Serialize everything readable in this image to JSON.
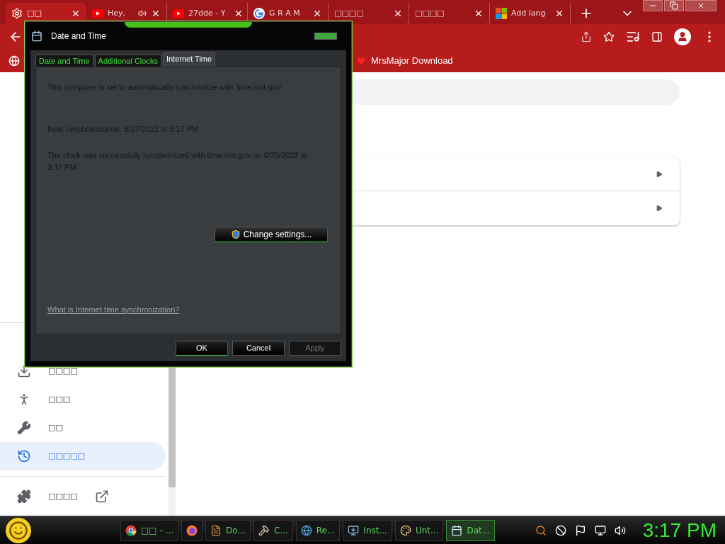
{
  "browser": {
    "tabs": [
      {
        "title": "□□",
        "kind": "gear",
        "selected": true,
        "audio": false
      },
      {
        "title": "Hey,",
        "kind": "youtube",
        "selected": false,
        "audio": true
      },
      {
        "title": "27dde - Y",
        "kind": "youtube",
        "selected": false,
        "audio": false
      },
      {
        "title": "G R A M",
        "kind": "google",
        "selected": false,
        "audio": false
      },
      {
        "title": "□□□□",
        "kind": "blank",
        "selected": false,
        "audio": false
      },
      {
        "title": "□□□□",
        "kind": "blank",
        "selected": false,
        "audio": false
      },
      {
        "title": "Add lang",
        "kind": "windows",
        "selected": false,
        "audio": false
      }
    ],
    "bookmarks": [
      {
        "label": "MrsMajor Download"
      }
    ],
    "sidebar": {
      "items": [
        {
          "label": "□□□□",
          "kind": "download",
          "selected": false,
          "external": false
        },
        {
          "label": "□□□",
          "kind": "accessibility",
          "selected": false,
          "external": false
        },
        {
          "label": "□□",
          "kind": "wrench",
          "selected": false,
          "external": false
        },
        {
          "label": "□□□□□",
          "kind": "history",
          "selected": true,
          "external": false
        },
        {
          "label": "□□□□",
          "kind": "puzzle",
          "selected": false,
          "external": true
        }
      ]
    }
  },
  "dialog": {
    "title": "Date and Time",
    "tabs": [
      {
        "label": "Date and Time",
        "selected": false
      },
      {
        "label": "Additional Clocks",
        "selected": false
      },
      {
        "label": "Internet Time",
        "selected": true
      }
    ],
    "lines": [
      "This computer is set to automatically synchronize with 'time.nist.gov'.",
      "Next synchronization: 8/27/2022 at 3:17 PM",
      "The clock was successfully synchronized with time.nist.gov on 8/20/2022 at 3:17 PM."
    ],
    "change_settings": "Change settings...",
    "help_link": "What is Internet time synchronization?",
    "buttons": [
      {
        "label": "OK",
        "disabled": false
      },
      {
        "label": "Cancel",
        "disabled": false
      },
      {
        "label": "Apply",
        "disabled": true
      }
    ]
  },
  "taskbar": {
    "items": [
      {
        "label": "□□ - ...",
        "kind": "chrome",
        "selected": false
      },
      {
        "kind": "firefox",
        "selected": false
      },
      {
        "label": "Do...",
        "kind": "doc",
        "selected": false
      },
      {
        "label": "C...",
        "kind": "tools",
        "selected": false
      },
      {
        "label": "Re...",
        "kind": "globe",
        "selected": false
      },
      {
        "label": "Inst...",
        "kind": "install",
        "selected": false
      },
      {
        "label": "Unt...",
        "kind": "paint",
        "selected": false
      },
      {
        "label": "Dat...",
        "kind": "calendar",
        "selected": true
      }
    ],
    "clock": "3:17 PM"
  }
}
